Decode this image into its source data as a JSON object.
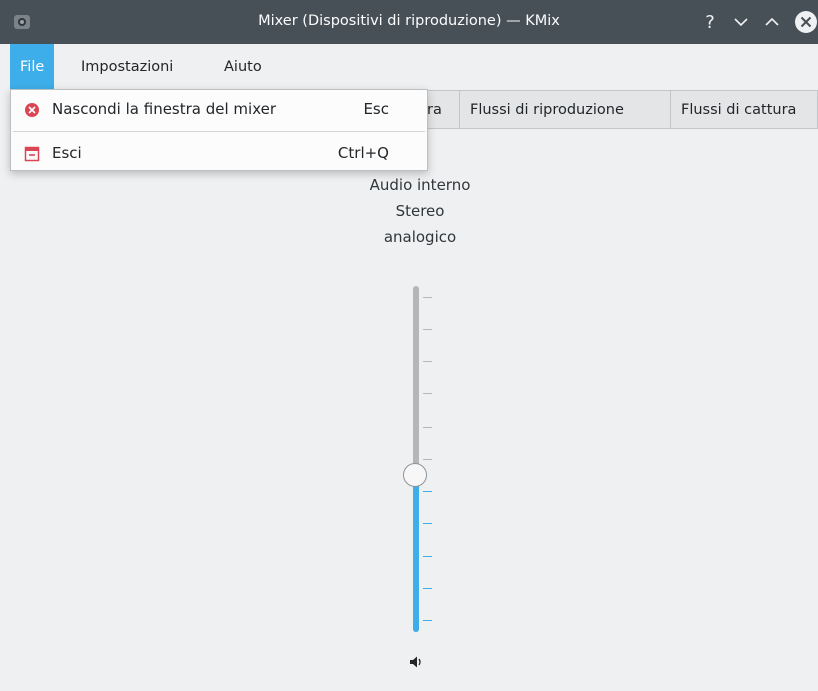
{
  "window": {
    "title": "Mixer (Dispositivi di riproduzione) — KMix",
    "controls": [
      "help-icon",
      "minimize-icon",
      "maximize-icon",
      "close-icon"
    ]
  },
  "menubar": {
    "items": [
      {
        "label": "File",
        "active": true
      },
      {
        "label": "Impostazioni",
        "active": false
      },
      {
        "label": "Aiuto",
        "active": false
      }
    ]
  },
  "file_menu": {
    "items": [
      {
        "label": "Nascondi la finestra del mixer",
        "shortcut": "Esc",
        "icon": "close-circle-icon"
      },
      {
        "label": "Esci",
        "shortcut": "Ctrl+Q",
        "icon": "quit-icon"
      }
    ]
  },
  "tabs": [
    {
      "label": "ra",
      "partial": true
    },
    {
      "label": "Flussi di riproduzione"
    },
    {
      "label": "Flussi di cattura"
    }
  ],
  "channel": {
    "name_line1": "Audio interno",
    "name_line2": "Stereo",
    "name_line3": "analogico",
    "volume_fraction": 0.45,
    "mute_icon": "speaker-icon"
  },
  "colors": {
    "titlebar": "#475057",
    "accent": "#3daee9",
    "background": "#eff0f1",
    "close_red": "#da4453"
  }
}
